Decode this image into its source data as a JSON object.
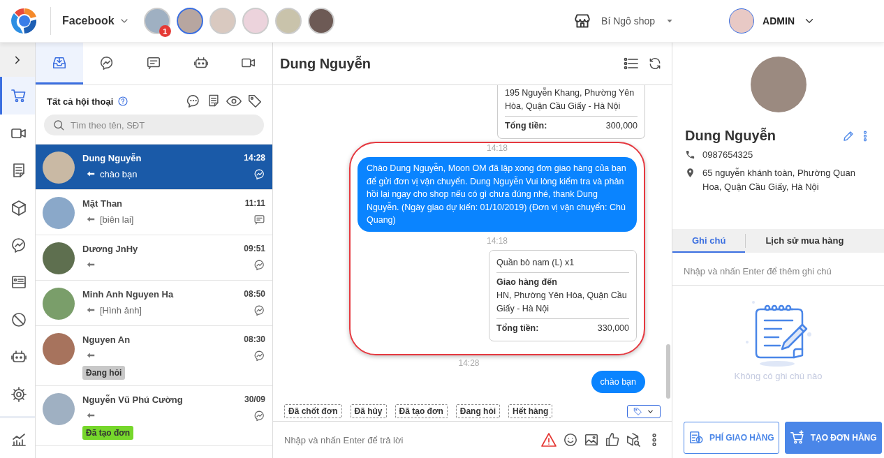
{
  "header": {
    "channel": "Facebook",
    "pages": [
      {
        "selected": false,
        "badge": "1"
      },
      {
        "selected": true
      },
      {
        "selected": false
      },
      {
        "selected": false
      },
      {
        "selected": false
      },
      {
        "selected": false
      }
    ],
    "shop": "Bí Ngô shop",
    "user": "ADMIN"
  },
  "rail": {
    "items": [
      {
        "selected": true
      },
      {
        "selected": false
      },
      {
        "selected": false
      },
      {
        "selected": false
      },
      {
        "selected": false
      },
      {
        "selected": false
      },
      {
        "selected": false
      },
      {
        "selected": false
      },
      {
        "selected": false
      },
      {
        "selected": false
      }
    ]
  },
  "conversations": {
    "tabs": [
      {
        "selected": true
      },
      {
        "selected": false
      },
      {
        "selected": false
      },
      {
        "selected": false
      },
      {
        "selected": false
      }
    ],
    "title": "Tất cả hội thoại",
    "search": {
      "placeholder": "Tìm theo tên, SĐT"
    },
    "items": [
      {
        "name": "Dung Nguyễn",
        "time": "14:28",
        "preview": "chào bạn",
        "kind": "messenger",
        "selected": true
      },
      {
        "name": "Mặt Than",
        "time": "11:11",
        "preview": "[biên lai]",
        "kind": "comment",
        "selected": false
      },
      {
        "name": "Dương JnHy",
        "time": "09:51",
        "kind": "messenger",
        "selected": false
      },
      {
        "name": "Minh Anh Nguyen Ha",
        "time": "08:50",
        "preview": "[Hình ảnh]",
        "kind": "messenger",
        "selected": false
      },
      {
        "name": "Nguyen An",
        "time": "08:30",
        "kind": "messenger",
        "selected": false,
        "tag": {
          "label": "Đang hỏi",
          "color": "#c8c8c8"
        }
      },
      {
        "name": "Nguyễn Vũ Phú Cường",
        "time": "30/09",
        "kind": "messenger",
        "selected": false,
        "tag": {
          "label": "Đã tạo đơn",
          "color": "#76d72b"
        }
      }
    ]
  },
  "chat": {
    "title": "Dung Nguyễn",
    "messages": [
      {
        "kind": "order",
        "address": "195 Nguyễn Khang, Phường Yên Hòa, Quận Cầu Giấy - Hà Nội",
        "total_label": "Tổng tiền:",
        "total": "300,000",
        "highlighted": false
      },
      {
        "kind": "time",
        "text": "14:18",
        "highlighted": true
      },
      {
        "kind": "outgoing",
        "text": "Chào Dung Nguyễn, Moon OM đã lập xong đơn giao hàng của bạn để gửi đơn vị vận chuyển. Dung Nguyễn Vui lòng kiểm tra và phản hồi lại ngay cho shop nếu có gì chưa đúng nhé, thank Dung Nguyễn. (Ngày giao dự kiến: 01/10/2019) (Đơn vị vận chuyển: Chú Quang)",
        "highlighted": true
      },
      {
        "kind": "time",
        "text": "14:18",
        "highlighted": true
      },
      {
        "kind": "order",
        "item": "Quần bò nam (L) x1",
        "address_label": "Giao hàng đến",
        "address": "HN, Phường Yên Hòa, Quận Cầu Giấy - Hà Nội",
        "total_label": "Tổng tiền:",
        "total": "330,000",
        "highlighted": true
      },
      {
        "kind": "time",
        "text": "14:28",
        "highlighted": false
      },
      {
        "kind": "outgoing",
        "text": "chào bạn",
        "highlighted": false
      }
    ],
    "tags": [
      "Đã chốt đơn",
      "Đã hủy",
      "Đã tạo đơn",
      "Đang hỏi",
      "Hết hàng"
    ],
    "composer": {
      "placeholder": "Nhập và nhấn Enter để trả lời"
    }
  },
  "customer": {
    "name": "Dung Nguyễn",
    "phone": "0987654325",
    "address": "65 nguyễn khánh toàn, Phường Quan Hoa, Quận Cầu Giấy, Hà Nội",
    "tabs": [
      {
        "label": "Ghi chú",
        "selected": true
      },
      {
        "label": "Lịch sử mua hàng",
        "selected": false
      }
    ],
    "note": {
      "placeholder": "Nhập và nhấn Enter để thêm ghi chú"
    },
    "empty_text": "Không có ghi chú nào",
    "buttons": [
      {
        "label": "PHÍ GIAO HÀNG",
        "kind": "outline"
      },
      {
        "label": "TẠO ĐƠN HÀNG",
        "kind": "primary"
      }
    ]
  }
}
